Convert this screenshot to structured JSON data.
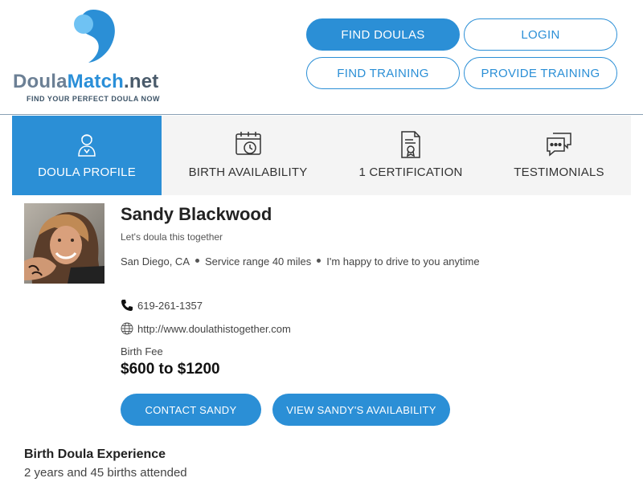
{
  "logo": {
    "doula": "Doula",
    "match": "Match",
    "net": ".net",
    "tagline": "FIND YOUR PERFECT DOULA NOW"
  },
  "nav": {
    "find_doulas": "FIND DOULAS",
    "login": "LOGIN",
    "find_training": "FIND TRAINING",
    "provide_training": "PROVIDE TRAINING"
  },
  "tabs": [
    {
      "label": "DOULA PROFILE",
      "icon": "doula-person-icon",
      "active": true
    },
    {
      "label": "BIRTH AVAILABILITY",
      "icon": "calendar-clock-icon",
      "active": false
    },
    {
      "label": "1 CERTIFICATION",
      "icon": "certificate-icon",
      "active": false
    },
    {
      "label": "TESTIMONIALS",
      "icon": "chat-bubbles-icon",
      "active": false
    }
  ],
  "profile": {
    "name": "Sandy Blackwood",
    "tagline": "Let's doula this together",
    "city": "San Diego, CA",
    "range": "Service range 40 miles",
    "travel": "I'm happy to drive to you anytime",
    "phone": "619-261-1357",
    "website": "http://www.doulathistogether.com",
    "fee_label": "Birth Fee",
    "fee": "$600 to $1200"
  },
  "actions": {
    "contact": "CONTACT SANDY",
    "availability": "VIEW SANDY'S AVAILABILITY"
  },
  "experience": {
    "title": "Birth Doula Experience",
    "text": "2 years and 45 births attended"
  },
  "colors": {
    "accent": "#2b8fd6",
    "tab_bg": "#f4f4f4"
  }
}
